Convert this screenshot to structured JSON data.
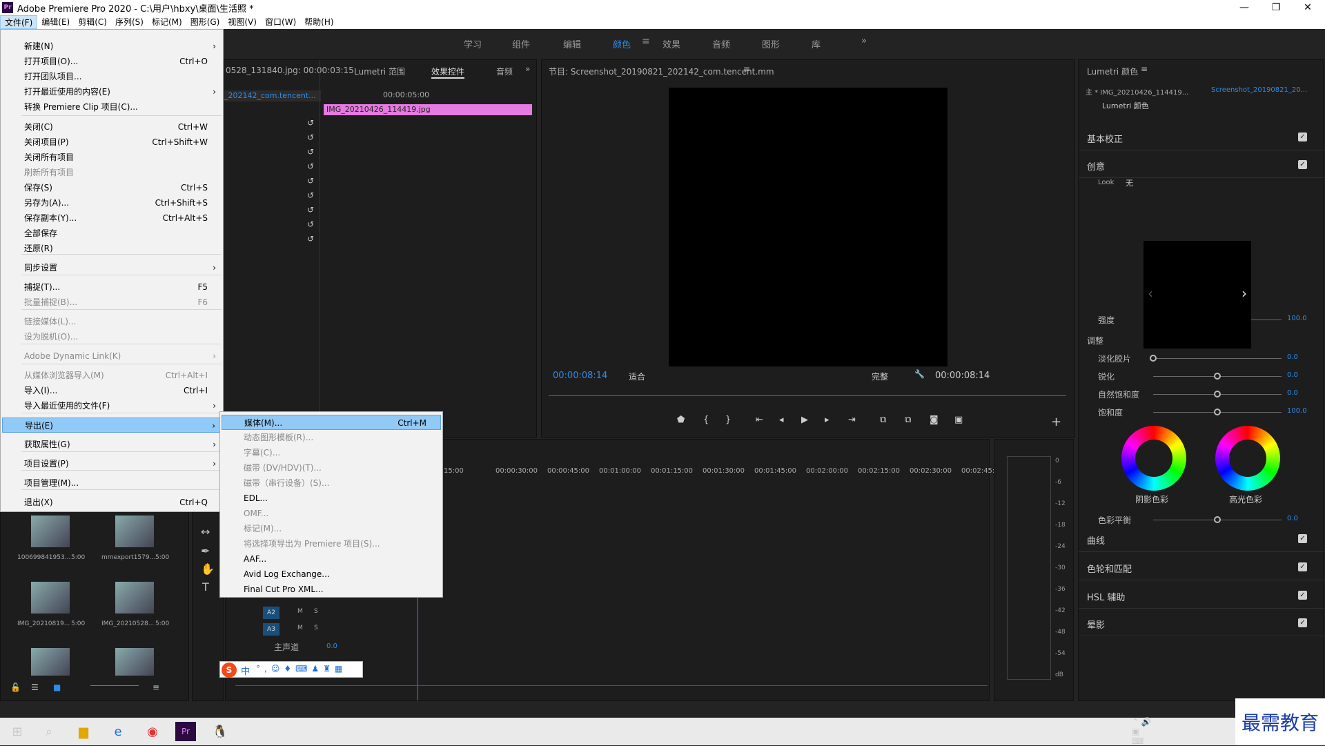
{
  "window": {
    "title": "Adobe Premiere Pro 2020 - C:\\用户\\hbxy\\桌面\\生活照 *",
    "logo": "Pr"
  },
  "menubar": [
    "文件(F)",
    "编辑(E)",
    "剪辑(C)",
    "序列(S)",
    "标记(M)",
    "图形(G)",
    "视图(V)",
    "窗口(W)",
    "帮助(H)"
  ],
  "workspaces": [
    "学习",
    "组件",
    "编辑",
    "颜色",
    "效果",
    "音频",
    "图形",
    "库"
  ],
  "file_menu": [
    {
      "label": "新建(N)",
      "shortcut": "",
      "arrow": true,
      "disabled": false
    },
    {
      "label": "打开项目(O)...",
      "shortcut": "Ctrl+O",
      "disabled": false
    },
    {
      "label": "打开团队项目...",
      "shortcut": "",
      "disabled": false
    },
    {
      "label": "打开最近使用的内容(E)",
      "shortcut": "",
      "arrow": true,
      "disabled": false
    },
    {
      "label": "转换 Premiere Clip 项目(C)...",
      "shortcut": "",
      "disabled": false
    },
    {
      "label": "关闭(C)",
      "shortcut": "Ctrl+W",
      "disabled": false
    },
    {
      "label": "关闭项目(P)",
      "shortcut": "Ctrl+Shift+W",
      "disabled": false
    },
    {
      "label": "关闭所有项目",
      "shortcut": "",
      "disabled": false
    },
    {
      "label": "刷新所有项目",
      "shortcut": "",
      "disabled": true
    },
    {
      "label": "保存(S)",
      "shortcut": "Ctrl+S",
      "disabled": false
    },
    {
      "label": "另存为(A)...",
      "shortcut": "Ctrl+Shift+S",
      "disabled": false
    },
    {
      "label": "保存副本(Y)...",
      "shortcut": "Ctrl+Alt+S",
      "disabled": false
    },
    {
      "label": "全部保存",
      "shortcut": "",
      "disabled": false
    },
    {
      "label": "还原(R)",
      "shortcut": "",
      "disabled": false
    },
    {
      "label": "同步设置",
      "shortcut": "",
      "arrow": true,
      "disabled": false
    },
    {
      "label": "捕捉(T)...",
      "shortcut": "F5",
      "disabled": false
    },
    {
      "label": "批量捕捉(B)...",
      "shortcut": "F6",
      "disabled": true
    },
    {
      "label": "链接媒体(L)...",
      "shortcut": "",
      "disabled": true
    },
    {
      "label": "设为脱机(O)...",
      "shortcut": "",
      "disabled": true
    },
    {
      "label": "Adobe Dynamic Link(K)",
      "shortcut": "",
      "arrow": true,
      "disabled": true
    },
    {
      "label": "从媒体浏览器导入(M)",
      "shortcut": "Ctrl+Alt+I",
      "disabled": true
    },
    {
      "label": "导入(I)...",
      "shortcut": "Ctrl+I",
      "disabled": false
    },
    {
      "label": "导入最近使用的文件(F)",
      "shortcut": "",
      "arrow": true,
      "disabled": false
    },
    {
      "label": "导出(E)",
      "shortcut": "",
      "arrow": true,
      "disabled": false,
      "highlighted": true
    },
    {
      "label": "获取属性(G)",
      "shortcut": "",
      "arrow": true,
      "disabled": false
    },
    {
      "label": "项目设置(P)",
      "shortcut": "",
      "arrow": true,
      "disabled": false
    },
    {
      "label": "项目管理(M)...",
      "shortcut": "",
      "disabled": false
    },
    {
      "label": "退出(X)",
      "shortcut": "Ctrl+Q",
      "disabled": false
    }
  ],
  "export_menu": [
    {
      "label": "媒体(M)...",
      "shortcut": "Ctrl+M",
      "highlighted": true,
      "disabled": false
    },
    {
      "label": "动态图形模板(R)...",
      "disabled": true
    },
    {
      "label": "字幕(C)...",
      "disabled": true
    },
    {
      "label": "磁带 (DV/HDV)(T)...",
      "disabled": true
    },
    {
      "label": "磁带（串行设备）(S)...",
      "disabled": true
    },
    {
      "label": "EDL...",
      "disabled": false
    },
    {
      "label": "OMF...",
      "disabled": true
    },
    {
      "label": "标记(M)...",
      "disabled": true
    },
    {
      "label": "将选择项导出为 Premiere 项目(S)...",
      "disabled": true
    },
    {
      "label": "AAF...",
      "disabled": false
    },
    {
      "label": "Avid Log Exchange...",
      "disabled": false
    },
    {
      "label": "Final Cut Pro XML...",
      "disabled": false
    }
  ],
  "source_panel": {
    "tab1": "0528_131840.jpg: 00:00:03:15",
    "tab2": "Lumetri 范围",
    "tab3": "效果控件",
    "tab4": "音频",
    "timecode": "00:00:05:00",
    "clip_left": "_202142_com.tencent...",
    "clip": "IMG_20210426_114419.jpg"
  },
  "program": {
    "title": "节目: Screenshot_20190821_202142_com.tencent.mm",
    "timecode_left": "00:00:08:14",
    "fit": "适合",
    "quality": "完整",
    "timecode_right": "00:00:08:14"
  },
  "timeline": {
    "ruler": [
      "15:00",
      "00:00:30:00",
      "00:00:45:00",
      "00:01:00:00",
      "00:01:15:00",
      "00:01:30:00",
      "00:01:45:00",
      "00:02:00:00",
      "00:02:15:00",
      "00:02:30:00",
      "00:02:45:00"
    ],
    "tracks": [
      "A2",
      "A3"
    ],
    "master": "主声道",
    "master_val": "0.0"
  },
  "meter": [
    "0",
    "-6",
    "-12",
    "-18",
    "-24",
    "-30",
    "-36",
    "-42",
    "-48",
    "-54",
    "dB"
  ],
  "media": [
    {
      "name": "100699841953...",
      "dur": "5:00"
    },
    {
      "name": "mmexport1579...",
      "dur": "5:00"
    },
    {
      "name": "IMG_20210819...",
      "dur": "5:00"
    },
    {
      "name": "IMG_20210528...",
      "dur": "5:00"
    }
  ],
  "lumetri": {
    "title": "Lumetri 颜色",
    "master": "主 * IMG_20210426_114419...",
    "clip": "Screenshot_20190821_20...",
    "fx": "Lumetri 颜色",
    "basic": "基本校正",
    "creative": "创意",
    "look_label": "Look",
    "look_value": "无",
    "intensity": "强度",
    "intensity_val": "100.0",
    "intensity_level": 0.5,
    "adjust": "调整",
    "faded": "淡化胶片",
    "faded_val": "0.0",
    "sharpen": "锐化",
    "sharpen_val": "0.0",
    "vibrance": "自然饱和度",
    "vibrance_val": "0.0",
    "saturation": "饱和度",
    "saturation_val": "100.0",
    "shadow": "阴影色彩",
    "highlight": "高光色彩",
    "balance": "色彩平衡",
    "balance_val": "0.0",
    "curves": "曲线",
    "wheels": "色轮和匹配",
    "hsl": "HSL 辅助",
    "vignette": "晕影"
  },
  "watermark": "最需教育",
  "ime": "中"
}
